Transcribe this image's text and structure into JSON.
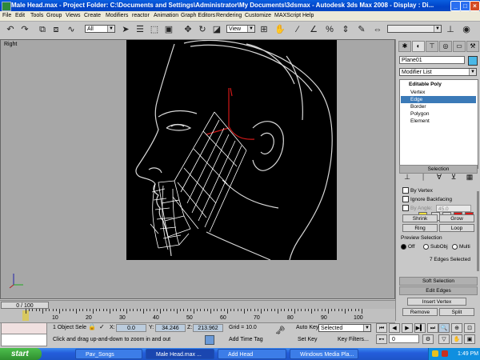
{
  "window": {
    "title": "Male Head.max - Project Folder: C:\\Documents and Settings\\Administrator\\My Documents\\3dsmax - Autodesk 3ds Max 2008 - Display : Di..."
  },
  "menu": [
    "File",
    "Edit",
    "Tools",
    "Group",
    "Views",
    "Create",
    "Modifiers",
    "reactor",
    "Animation",
    "Graph Editors",
    "Rendering",
    "Customize",
    "MAXScript",
    "Help"
  ],
  "toolbar": {
    "selection_filter": "All",
    "ref_coord": "View"
  },
  "viewport": {
    "label": "Right"
  },
  "command_panel": {
    "object_name": "Plane01",
    "modifier_list": "Modifier List",
    "stack": [
      "Editable Poly",
      "Vertex",
      "Edge",
      "Border",
      "Polygon",
      "Element"
    ],
    "selected_stack_item": "Edge",
    "selection": {
      "title": "Selection",
      "by_vertex": "By Vertex",
      "ignore_backfacing": "Ignore Backfacing",
      "by_angle": "By Angle:",
      "angle_value": "45.0",
      "shrink": "Shrink",
      "grow": "Grow",
      "ring": "Ring",
      "loop": "Loop",
      "preview_title": "Preview Selection",
      "preview_options": [
        "Off",
        "SubObj",
        "Multi"
      ],
      "status": "7 Edges Selected"
    },
    "soft_selection": "Soft Selection",
    "edit_edges": {
      "title": "Edit Edges",
      "insert_vertex": "Insert Vertex",
      "remove": "Remove",
      "split": "Split"
    }
  },
  "timeline": {
    "slider": "0 / 100",
    "ticks": [
      "10",
      "20",
      "30",
      "40",
      "50",
      "60",
      "70",
      "80",
      "90",
      "100"
    ]
  },
  "status": {
    "selected": "1 Object Sele",
    "x_label": "X:",
    "x": "0.0",
    "y_label": "Y:",
    "y": "34.246",
    "z_label": "Z:",
    "z": "213.962",
    "grid": "Grid = 10.0",
    "prompt": "Click and drag up-and-down to zoom in and out",
    "add_time_tag": "Add Time Tag",
    "auto_key": "Auto Key",
    "auto_key_mode": "Selected",
    "set_key": "Set Key",
    "key_filters": "Key Filters...",
    "frame": "0"
  },
  "taskbar": {
    "start": "start",
    "tasks": [
      "Pav_Songs",
      "Male Head.max ...",
      "Add Head",
      "Windows Media Pla..."
    ],
    "clock": "1:49 PM"
  }
}
